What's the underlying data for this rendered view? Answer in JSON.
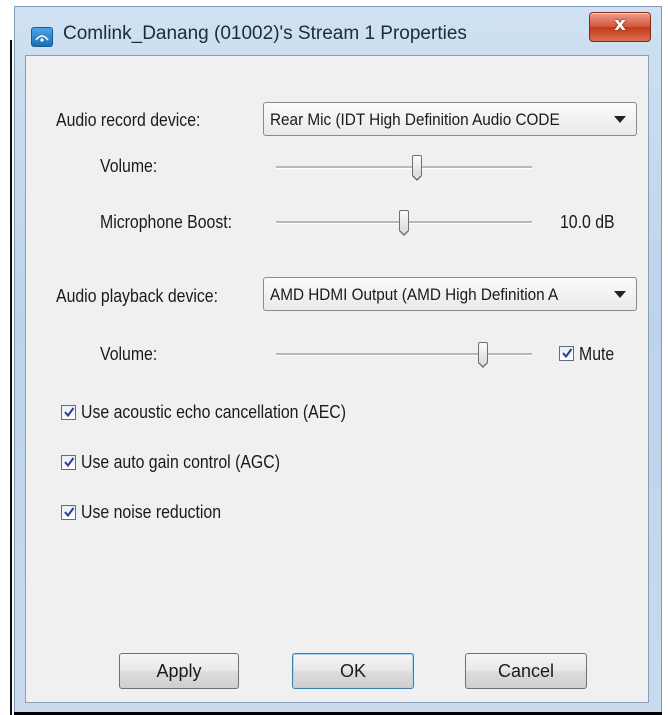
{
  "window": {
    "title": "Comlink_Danang (01002)'s Stream 1 Properties",
    "close_label": "x",
    "app_icon": "stream-icon"
  },
  "record": {
    "device_label": "Audio record device:",
    "device_value": "Rear Mic (IDT High Definition Audio CODE",
    "volume_label": "Volume:",
    "volume_level": 0.55,
    "boost_label": "Microphone Boost:",
    "boost_level": 0.5,
    "boost_value": "10.0 dB"
  },
  "playback": {
    "device_label": "Audio playback device:",
    "device_value": "AMD HDMI Output (AMD High Definition A",
    "volume_label": "Volume:",
    "volume_level": 0.81,
    "mute_label": "Mute",
    "mute_checked": true
  },
  "options": [
    {
      "label": "Use acoustic echo cancellation (AEC)",
      "checked": true
    },
    {
      "label": "Use auto gain control (AGC)",
      "checked": true
    },
    {
      "label": "Use noise reduction",
      "checked": true
    }
  ],
  "buttons": {
    "apply": "Apply",
    "ok": "OK",
    "cancel": "Cancel"
  },
  "colors": {
    "titlebar": "#c4d8ee",
    "close": "#c9452a",
    "client": "#f0f0f0",
    "default_button_border": "#3c7fb1"
  }
}
